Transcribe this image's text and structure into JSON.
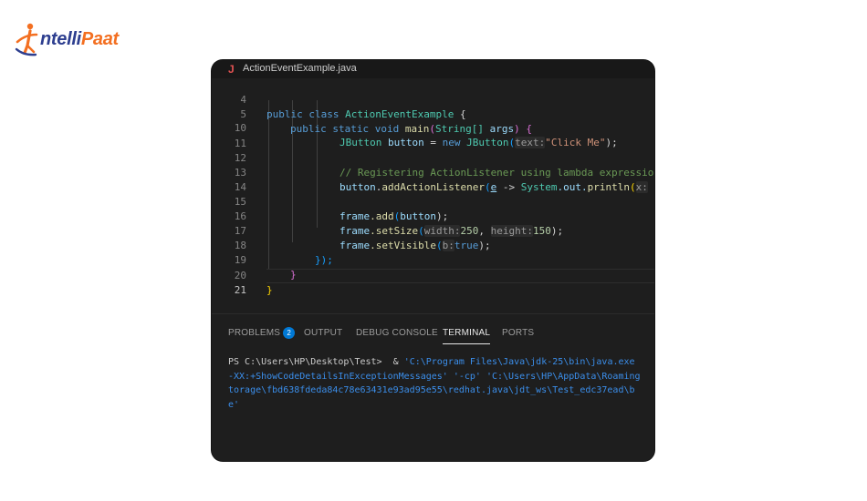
{
  "brand": {
    "name_prefix": "ntelli",
    "name_suffix": "Paat",
    "mark_letter": "I"
  },
  "editor": {
    "tab_icon": "J",
    "tab_title": "ActionEventExample.java",
    "lines": [
      {
        "num": "4"
      },
      {
        "num": "5"
      },
      {
        "num": "10"
      },
      {
        "num": "11"
      },
      {
        "num": "12"
      },
      {
        "num": "13"
      },
      {
        "num": "14"
      },
      {
        "num": "15"
      },
      {
        "num": "16"
      },
      {
        "num": "17"
      },
      {
        "num": "18"
      },
      {
        "num": "19"
      },
      {
        "num": "20"
      },
      {
        "num": "21"
      }
    ],
    "code": {
      "l4": {
        "kw1": "public",
        "kw2": "class",
        "cls": "ActionEventExample",
        "brace": "{"
      },
      "l5": {
        "kw1": "public",
        "kw2": "static",
        "kw3": "void",
        "fn": "main",
        "p_open": "(",
        "type": "String[]",
        "arg": "args",
        "p_close": ")",
        "brace": "{"
      },
      "l10": {
        "type": "JButton",
        "var": "button",
        "eq": "=",
        "kw": "new",
        "ctor": "JButton",
        "p_open": "(",
        "hint": "text:",
        "str": "\"Click Me\"",
        "p_close": ");"
      },
      "l12": {
        "comment": "// Registering ActionListener using lambda expressio"
      },
      "l13": {
        "obj": "button",
        "dot": ".",
        "fn": "addActionListener",
        "p_open": "(",
        "param": "e",
        "arrow": "->",
        "cls": "System",
        "field": ".out.",
        "fn2": "println",
        "p2": "(",
        "hint": "x:"
      },
      "l15": {
        "obj": "frame",
        "fn": ".add",
        "p_open": "(",
        "arg": "button",
        "p_close": ");"
      },
      "l16": {
        "obj": "frame",
        "fn": ".setSize",
        "p_open": "(",
        "hint1": "width:",
        "v1": "250",
        "sep": ", ",
        "hint2": "height:",
        "v2": "150",
        "p_close": ");"
      },
      "l17": {
        "obj": "frame",
        "fn": ".setVisible",
        "p_open": "(",
        "hint": "b:",
        "v": "true",
        "p_close": ");"
      },
      "l18": {
        "text": "});"
      },
      "l19": {
        "text": "}"
      },
      "l20": {
        "text": "}"
      }
    }
  },
  "panel": {
    "tabs": [
      {
        "label": "PROBLEMS",
        "badge": "2"
      },
      {
        "label": "OUTPUT"
      },
      {
        "label": "DEBUG CONSOLE"
      },
      {
        "label": "TERMINAL"
      },
      {
        "label": "PORTS"
      }
    ],
    "active_tab": "TERMINAL",
    "terminal": {
      "prompt": "PS C:\\Users\\HP\\Desktop\\Test>",
      "operator": "&",
      "line1_cmd": "'C:\\Program Files\\Java\\jdk-25\\bin\\java.exe",
      "line2": "-XX:+ShowCodeDetailsInExceptionMessages' '-cp' 'C:\\Users\\HP\\AppData\\Roaming",
      "line3": "torage\\fbd638fdeda84c78e63431e93ad95e55\\redhat.java\\jdt_ws\\Test_edc37ead\\b",
      "line4": "e'"
    }
  },
  "colors": {
    "brand_blue": "#2d3e8f",
    "brand_orange": "#f36f21",
    "editor_bg": "#1e1e1e",
    "badge_blue": "#0078d4",
    "terminal_path": "#3b8eea"
  }
}
